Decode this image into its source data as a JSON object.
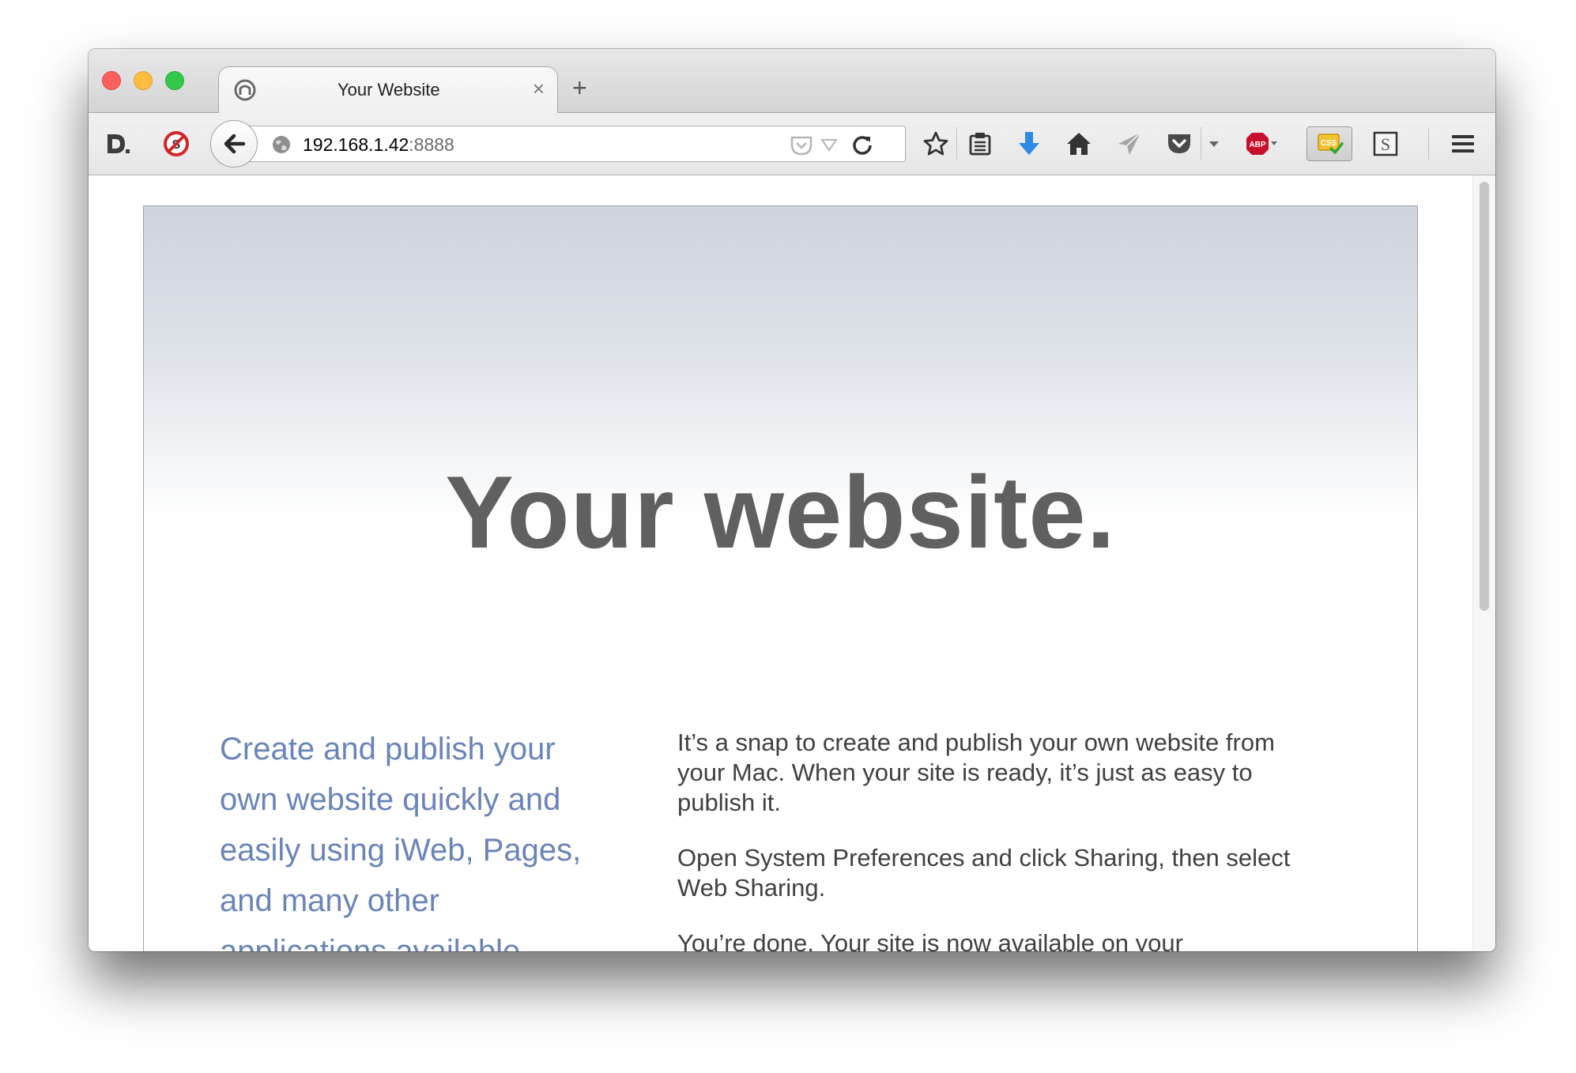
{
  "tab": {
    "title": "Your Website",
    "close_glyph": "×",
    "new_tab_glyph": "+"
  },
  "toolbar": {
    "url_host": "192.168.1.42",
    "url_port": ":8888",
    "icons": [
      "readability-d-icon",
      "no-script-icon",
      "back-arrow-icon",
      "globe-icon",
      "pocket-url-icon",
      "dropdown-arrow-icon",
      "reload-icon",
      "bookmark-star-icon",
      "reading-list-icon",
      "downloads-arrow-icon",
      "home-icon",
      "send-paper-plane-icon",
      "pocket-icon",
      "adblock-plus-icon",
      "css-validator-icon",
      "s-extension-icon",
      "hamburger-menu-icon"
    ],
    "adblock_label": "ABP",
    "css_label": "CSS"
  },
  "page": {
    "hero_title": "Your website.",
    "lead": "Create and publish your own website quickly and easily using iWeb, Pages, and many other applications available",
    "paragraphs": [
      "It’s a snap to create and publish your own website from your Mac. When your site is ready, it’s just as easy to publish it.",
      "Open System Preferences and click Sharing, then select Web Sharing.",
      "You’re done. Your site is now available on your"
    ]
  },
  "colors": {
    "close": "#fc605c",
    "minimize": "#fdbc40",
    "zoom": "#34c84a",
    "hero_title": "#606060",
    "lead_text": "#6a84b8",
    "body_text": "#404040",
    "download_blue": "#2e8ae6",
    "abp_red": "#c8102e"
  }
}
